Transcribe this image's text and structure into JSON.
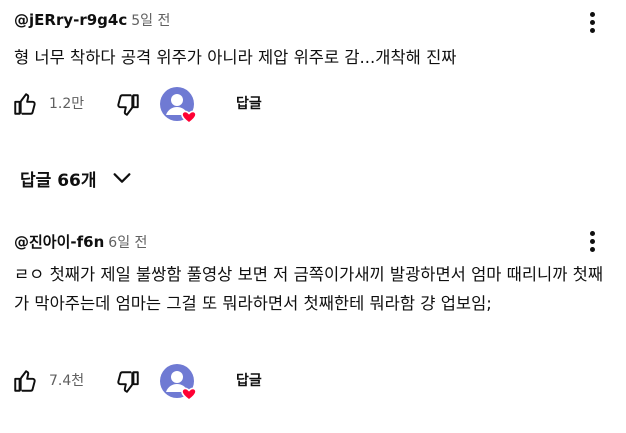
{
  "comments": [
    {
      "author": "@jERry-r9g4c",
      "time": "5일 전",
      "text": "형 너무 착하다 공격 위주가 아니라 제압 위주로 감...개착해 진짜",
      "like_count": "1.2만",
      "reply_label": "답글"
    },
    {
      "author": "@진아이-f6n",
      "time": "6일 전",
      "text": "ㄹㅇ 첫째가 제일 불쌍함 풀영상 보면 저 금쪽이가새끼 발광하면서 엄마 때리니까 첫째가 막아주는데 엄마는 그걸 또 뭐라하면서 첫째한테 뭐라함 걍 업보임;",
      "like_count": "7.4천",
      "reply_label": "답글"
    }
  ],
  "replies_toggle": {
    "label": "답글 66개"
  },
  "colors": {
    "heart": "#ff0033",
    "avatar_bg": "#6f7ad3",
    "secondary_text": "#606060"
  }
}
